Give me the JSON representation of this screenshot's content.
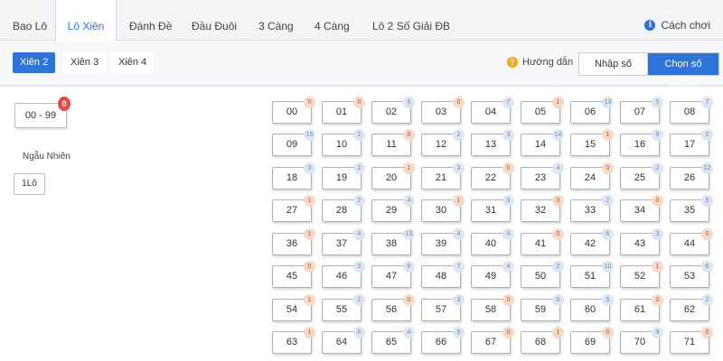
{
  "tabs": [
    {
      "label": "Bao Lô",
      "active": false
    },
    {
      "label": "Lô Xiên",
      "active": true
    },
    {
      "label": "Đánh Đề",
      "active": false
    },
    {
      "label": "Đầu Đuôi",
      "active": false
    },
    {
      "label": "3 Càng",
      "active": false
    },
    {
      "label": "4 Càng",
      "active": false
    },
    {
      "label": "Lô 2 Số Giải ĐB",
      "active": false
    }
  ],
  "help_label": "Cách chơi",
  "subtabs": [
    {
      "label": "Xiên 2",
      "active": true
    },
    {
      "label": "Xiên 3",
      "active": false
    },
    {
      "label": "Xiên 4",
      "active": false
    }
  ],
  "guide_label": "Hướng dẫn",
  "modes": [
    {
      "label": "Nhập số",
      "active": false
    },
    {
      "label": "Chọn số nhanh",
      "active": true
    }
  ],
  "range_label": "00 - 99",
  "range_badge": "0",
  "random_label": "Ngẫu Nhiên",
  "lo_label": "1Lô",
  "colors": {
    "accent": "#2d73d8",
    "badge_red": "#e84a4a",
    "badge_warm": "#f8d9c6",
    "badge_cool": "#dbe6f5"
  },
  "numbers": [
    {
      "n": "00",
      "c": "0"
    },
    {
      "n": "01",
      "c": "0"
    },
    {
      "n": "02",
      "c": "6"
    },
    {
      "n": "03",
      "c": "0"
    },
    {
      "n": "04",
      "c": "7"
    },
    {
      "n": "05",
      "c": "1"
    },
    {
      "n": "06",
      "c": "13"
    },
    {
      "n": "07",
      "c": "5"
    },
    {
      "n": "08",
      "c": "7"
    },
    {
      "n": "09",
      "c": "15"
    },
    {
      "n": "10",
      "c": "2"
    },
    {
      "n": "11",
      "c": "0"
    },
    {
      "n": "12",
      "c": "2"
    },
    {
      "n": "13",
      "c": "3"
    },
    {
      "n": "14",
      "c": "14"
    },
    {
      "n": "15",
      "c": "1"
    },
    {
      "n": "16",
      "c": "9"
    },
    {
      "n": "17",
      "c": "2"
    },
    {
      "n": "18",
      "c": "3"
    },
    {
      "n": "19",
      "c": "2"
    },
    {
      "n": "20",
      "c": "1"
    },
    {
      "n": "21",
      "c": "3"
    },
    {
      "n": "22",
      "c": "0"
    },
    {
      "n": "23",
      "c": "4"
    },
    {
      "n": "24",
      "c": "0"
    },
    {
      "n": "25",
      "c": "2"
    },
    {
      "n": "26",
      "c": "12"
    },
    {
      "n": "27",
      "c": "1"
    },
    {
      "n": "28",
      "c": "2"
    },
    {
      "n": "29",
      "c": "4"
    },
    {
      "n": "30",
      "c": "1"
    },
    {
      "n": "31",
      "c": "3"
    },
    {
      "n": "32",
      "c": "0"
    },
    {
      "n": "33",
      "c": "2"
    },
    {
      "n": "34",
      "c": "0"
    },
    {
      "n": "35",
      "c": "5"
    },
    {
      "n": "36",
      "c": "1"
    },
    {
      "n": "37",
      "c": "4"
    },
    {
      "n": "38",
      "c": "13"
    },
    {
      "n": "39",
      "c": "4"
    },
    {
      "n": "40",
      "c": "4"
    },
    {
      "n": "41",
      "c": "0"
    },
    {
      "n": "42",
      "c": "6"
    },
    {
      "n": "43",
      "c": "3"
    },
    {
      "n": "44",
      "c": "0"
    },
    {
      "n": "45",
      "c": "0"
    },
    {
      "n": "46",
      "c": "3"
    },
    {
      "n": "47",
      "c": "6"
    },
    {
      "n": "48",
      "c": "7"
    },
    {
      "n": "49",
      "c": "4"
    },
    {
      "n": "50",
      "c": "2"
    },
    {
      "n": "51",
      "c": "10"
    },
    {
      "n": "52",
      "c": "1"
    },
    {
      "n": "53",
      "c": "6"
    },
    {
      "n": "54",
      "c": "1"
    },
    {
      "n": "55",
      "c": "2"
    },
    {
      "n": "56",
      "c": "0"
    },
    {
      "n": "57",
      "c": "3"
    },
    {
      "n": "58",
      "c": "0"
    },
    {
      "n": "59",
      "c": "6"
    },
    {
      "n": "60",
      "c": "5"
    },
    {
      "n": "61",
      "c": "0"
    },
    {
      "n": "62",
      "c": "2"
    },
    {
      "n": "63",
      "c": "1"
    },
    {
      "n": "64",
      "c": "6"
    },
    {
      "n": "65",
      "c": "4"
    },
    {
      "n": "66",
      "c": "5"
    },
    {
      "n": "67",
      "c": "0"
    },
    {
      "n": "68",
      "c": "1"
    },
    {
      "n": "69",
      "c": "0"
    },
    {
      "n": "70",
      "c": "9"
    },
    {
      "n": "71",
      "c": "0"
    }
  ]
}
